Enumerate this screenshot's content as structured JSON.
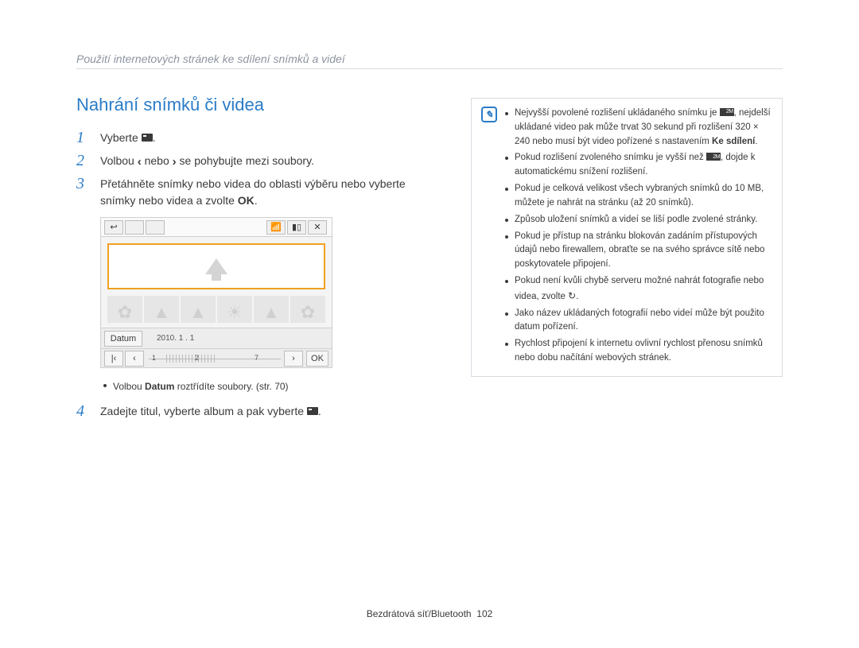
{
  "breadcrumb": "Použití internetových stránek ke sdílení snímků a videí",
  "title": "Nahrání snímků či videa",
  "steps": {
    "1": {
      "num": "1",
      "pre": "Vyberte ",
      "post": "."
    },
    "2": {
      "num": "2",
      "pre": "Volbou ",
      "mid": " nebo ",
      "post": " se pohybujte mezi soubory."
    },
    "3": {
      "num": "3",
      "a": "Přetáhněte snímky nebo videa do oblasti výběru nebo vyberte snímky nebo videa a zvolte ",
      "b": "OK",
      "c": "."
    },
    "4": {
      "num": "4",
      "pre": "Zadejte titul, vyberte album a pak vyberte ",
      "post": "."
    }
  },
  "device": {
    "toolbar": {
      "back": "↩",
      "wifi": "▮",
      "signal": "▯▮▮",
      "close": "✕",
      "generic": " "
    },
    "datum": "Datum",
    "date": "2010. 1 . 1",
    "nums": {
      "n1": "1",
      "n2": "2",
      "n7": "7"
    },
    "nav": {
      "first": "|‹",
      "prev": "‹",
      "next": "›",
      "last": "›|"
    },
    "ok": "OK"
  },
  "sub_bullet": {
    "a": "Volbou ",
    "b": "Datum",
    "c": " roztřídíte soubory. (str. 70)"
  },
  "info": {
    "items": [
      {
        "a": "Nejvyšší povolené rozlišení ukládaného snímku je ",
        "b": ", nejdelší ukládané video pak může trvat 30 sekund při rozlišení 320 × 240 nebo musí být video pořízené s nastavením ",
        "c": "Ke sdílení",
        "d": ".",
        "icon1": "res"
      },
      {
        "a": "Pokud rozlišení zvoleného snímku je vyšší než ",
        "b": ", dojde k automatickému snížení rozlišení.",
        "icon1": "res"
      },
      {
        "a": "Pokud je celková velikost všech vybraných snímků do 10 MB, můžete je nahrát na stránku (až 20 snímků)."
      },
      {
        "a": "Způsob uložení snímků a videí se liší podle zvolené stránky."
      },
      {
        "a": "Pokud je přístup na stránku blokován zadáním přístupových údajů nebo firewallem, obraťte se na svého správce sítě nebo poskytovatele připojení."
      },
      {
        "a": "Pokud není kvůli chybě serveru možné nahrát fotografie nebo videa, zvolte ",
        "b": ".",
        "icon2": "refresh"
      },
      {
        "a": "Jako název ukládaných fotografií nebo videí může být použito datum pořízení."
      },
      {
        "a": "Rychlost připojení k internetu ovlivní rychlost přenosu snímků nebo dobu načítání webových stránek."
      }
    ]
  },
  "footer": {
    "section": "Bezdrátová síť/Bluetooth",
    "page": "102"
  }
}
